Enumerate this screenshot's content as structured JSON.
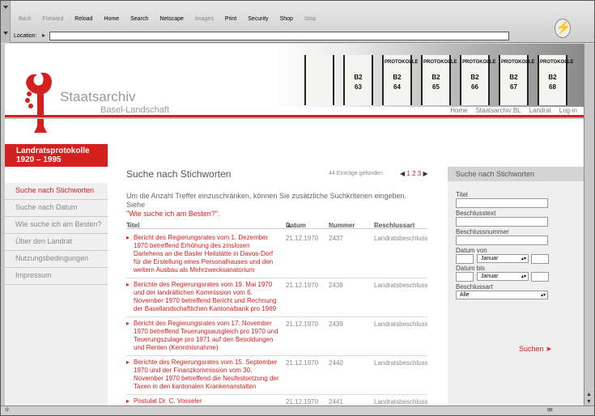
{
  "browser": {
    "buttons": [
      "Back",
      "Forward",
      "Reload",
      "Home",
      "Search",
      "Netscape",
      "Images",
      "Print",
      "Security",
      "Shop",
      "Stop"
    ],
    "disabled": [
      true,
      true,
      false,
      false,
      false,
      false,
      true,
      false,
      false,
      false,
      true
    ],
    "location_label": "Location:",
    "location_value": ""
  },
  "header": {
    "title": "Staatsarchiv",
    "subtitle": "Basel-Landschaft",
    "nav": [
      "Home",
      "Staatsarchiv BL",
      "Landrat",
      "Log-in"
    ],
    "books": [
      {
        "label": "",
        "num": ""
      },
      {
        "label": "",
        "num": "B2\n63"
      },
      {
        "label": "PROTOKOLLE",
        "num": "B2\n64"
      },
      {
        "label": "PROTOKOLLE",
        "num": "B2\n65"
      },
      {
        "label": "PROTOKOLLE",
        "num": "B2\n66"
      },
      {
        "label": "PROTOKOLLE",
        "num": "B2\n67"
      },
      {
        "label": "PROTOKOLLE",
        "num": "B2\n68"
      }
    ]
  },
  "sidebar": {
    "heading_line1": "Landratsprotokolle",
    "heading_line2": "1920 – 1995",
    "items": [
      "Suche nach Stichworten",
      "Suche nach Datum",
      "Wie suche ich am Besten?",
      "Über den Landrat",
      "Nutzungsbedingungen",
      "Impressum"
    ]
  },
  "main": {
    "heading": "Suche nach Stichworten",
    "count": "44 Einträge gefunden",
    "pages": [
      "1",
      "2",
      "3"
    ],
    "intro_text": "Um die Anzahl Treffer einzuschränken, können Sie zusätzliche Suchkriterien eingeben. Siehe",
    "intro_link": "\"Wie suche ich am Besten?\".",
    "columns": [
      "Titel",
      "Datum",
      "Nummer",
      "Beschlussart"
    ],
    "rows": [
      {
        "title": "Bericht des Regierungsrates vom 1. Dezember 1970 betreffend Erhöhung des zinslosen Darlehens an die Basler Heilstätte in Davos-Dorf für die Erstellung eines Personalhauses und den weitern Ausbau als Mehrzwecksanatorium",
        "date": "21.12.1970",
        "num": "2437",
        "type": "Landratsbeschluss"
      },
      {
        "title": "Berichte des Regierungsrates vom 19. Mai 1970 und der landrätlichen Kommission vom 6. November 1970 betreffend Bericht und Rechnung der Basellandschaftlichen Kantonalbank pro 1969",
        "date": "21.12.1970",
        "num": "2438",
        "type": "Landratsbeschluss"
      },
      {
        "title": "Bericht des Regierungsrates vom 17. November 1970 betreffend Teuerungsausgleich pro 1970 und Teuerungszulage pro 1971 auf den Besoldungen und Renten (Kenntnisnahme)",
        "date": "21.12.1970",
        "num": "2439",
        "type": "Landratsbeschluss"
      },
      {
        "title": "Berichte des Regierungsrates vom 15. September 1970 und der Finanzkommission vom 30. November 1970 betreffend die Neufestsetzung der Taxen in den kantonalen Krankenanstalten",
        "date": "21.12.1970",
        "num": "2440",
        "type": "Landratsbeschluss"
      },
      {
        "title": "Postulat Dr. C. Vosseler",
        "date": "21.12.1970",
        "num": "2441",
        "type": "Landratsbeschluss"
      }
    ]
  },
  "search_panel": {
    "heading": "Suche nach Stichworten",
    "titel_label": "Titel",
    "text_label": "Beschlusstext",
    "nummer_label": "Beschlussnummer",
    "von_label": "Datum von",
    "bis_label": "Datum bis",
    "month_value": "Januar",
    "art_label": "Beschlussart",
    "art_value": "Alle",
    "submit": "Suchen"
  },
  "colors": {
    "accent": "#d52020"
  }
}
